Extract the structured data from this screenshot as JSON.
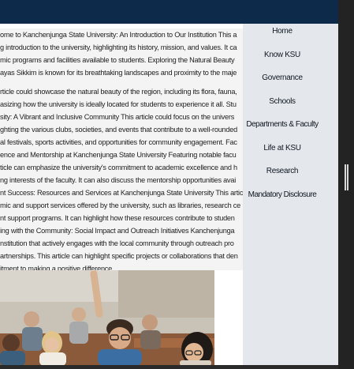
{
  "article": {
    "lines": [
      "ome to Kanchenjunga State University: An Introduction to Our Institution This a",
      "g introduction to the university, highlighting its history, mission, and values. It ca",
      "mic programs and facilities available to students. Exploring the Natural Beauty",
      "ayas Sikkim is known for its breathtaking landscapes and proximity to the maje",
      "rticle could showcase the natural beauty of the region, including its flora, fauna,",
      "asizing how the university is ideally located for students to experience it all. Stu",
      "sity: A Vibrant and Inclusive Community This article could focus on the univers",
      "ghting the various clubs, societies, and events that contribute to a well-rounded",
      "al festivals, sports activities, and opportunities for community engagement. Fac",
      "ence and Mentorship at Kanchenjunga State University Featuring notable facu",
      "ticle can emphasize the university's commitment to academic excellence and h",
      "ng interests of the faculty. It can also discuss the mentorship opportunities avai",
      "nt Success: Resources and Services at Kanchenjunga State University This artic",
      "mic and support services offered by the university, such as libraries, research ce",
      "nt support programs. It can highlight how these resources contribute to studen",
      "ing with the Community: Social Impact and Outreach Initiatives Kanchenjunga",
      "nstitution that actively engages with the local community through outreach pro",
      "artnerships. This article can highlight specific projects or collaborations that den",
      "itment to making a positive difference."
    ]
  },
  "nav": {
    "items": [
      "Home",
      "Know KSU",
      "Governance",
      "Schools",
      "Departments & Faculty",
      "Life at KSU",
      "Research",
      "Mandatory Disclosure"
    ]
  },
  "colors": {
    "topbar": "#0d2a4a",
    "sidebar": "#e4e7ec",
    "scroll_track": "#232323"
  }
}
